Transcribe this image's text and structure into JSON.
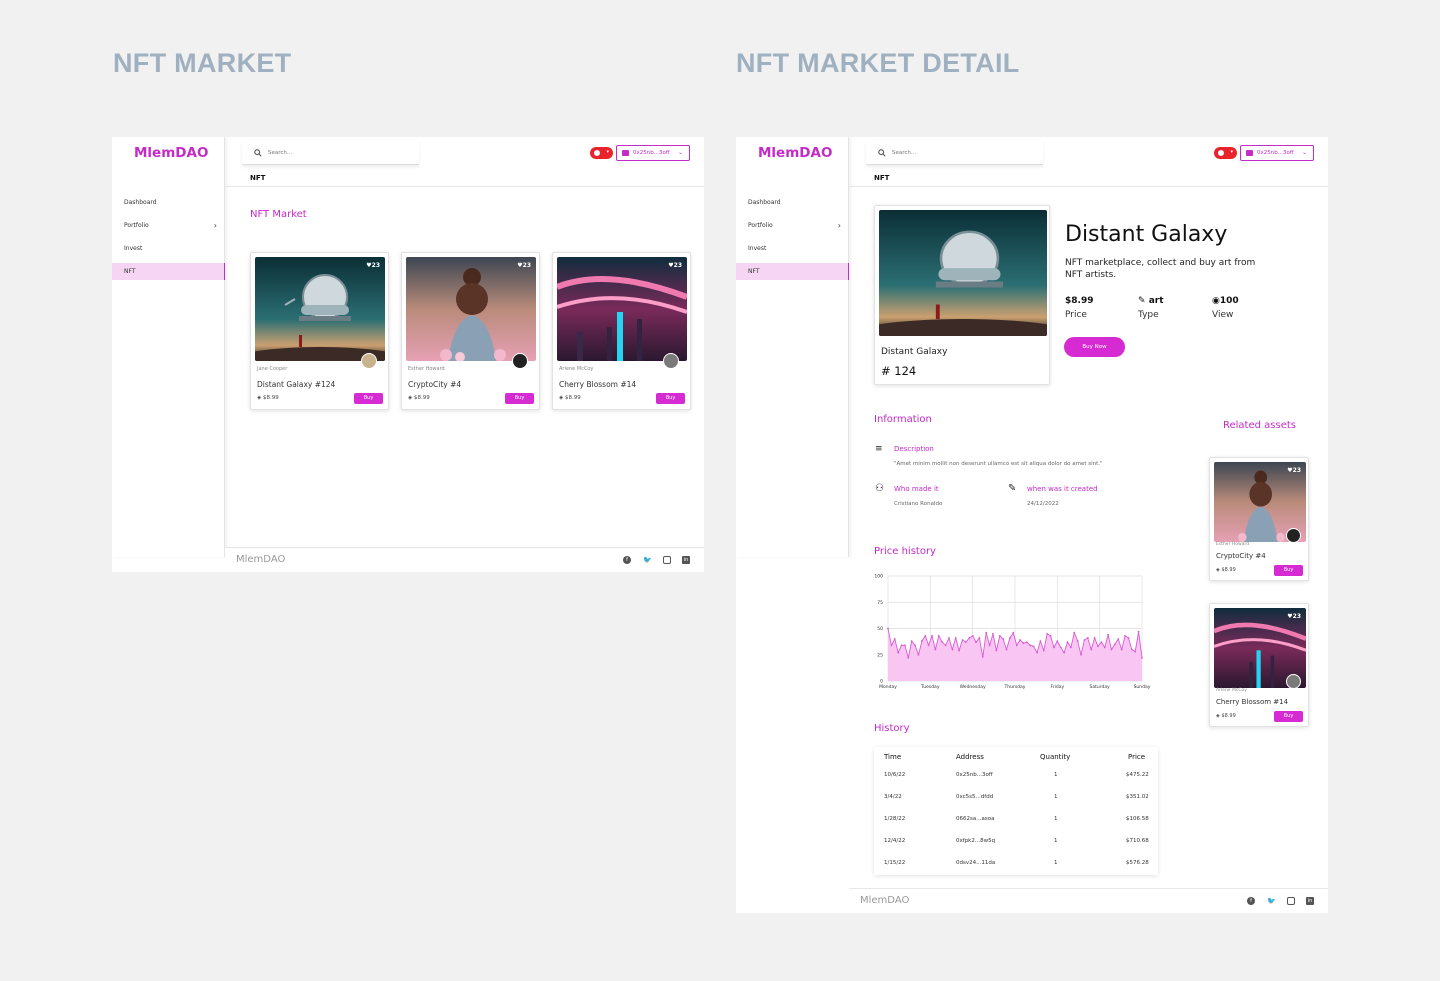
{
  "headings": {
    "left": "NFT MARKET",
    "right": "NFT MARKET DETAIL"
  },
  "brand": "MlemDAO",
  "sidebar": {
    "items": [
      {
        "label": "Dashboard",
        "has_chevron": false,
        "active": false
      },
      {
        "label": "Portfolio",
        "has_chevron": true,
        "active": false
      },
      {
        "label": "Invest",
        "has_chevron": false,
        "active": false
      },
      {
        "label": "NFT",
        "has_chevron": false,
        "active": true
      }
    ]
  },
  "search": {
    "placeholder": "Search..."
  },
  "wallet": {
    "address": "0x25nb...3off"
  },
  "breadcrumb": "NFT",
  "market": {
    "title": "NFT Market",
    "cards": [
      {
        "owner": "Jane Cooper",
        "name": "Distant Galaxy  #124",
        "price": "$8.99",
        "likes": "23",
        "buy": "Buy",
        "image": "galaxy"
      },
      {
        "owner": "Esther Howard",
        "name": "CryptoCity  #4",
        "price": "$8.99",
        "likes": "23",
        "buy": "Buy",
        "image": "girl"
      },
      {
        "owner": "Arlene McCoy",
        "name": "Cherry Blossom  #14",
        "price": "$8.99",
        "likes": "23",
        "buy": "Buy",
        "image": "city"
      }
    ]
  },
  "detail": {
    "title": "Distant Galaxy",
    "subtitle": "NFT marketplace, collect and buy art from NFT artists.",
    "card_name": "Distant Galaxy",
    "card_number": "# 124",
    "stats": [
      {
        "value": "$8.99",
        "label": "Price",
        "icon": "none"
      },
      {
        "value": "art",
        "label": "Type",
        "icon": "brush-icon"
      },
      {
        "value": "100",
        "label": "View",
        "icon": "eye-icon"
      }
    ],
    "buy_now": "Buy Now",
    "information": {
      "title": "Information",
      "description_label": "Description",
      "description_text": "\"Amet minim mollit non deserunt ullamco est sit aliqua dolor do amet sint.\"",
      "who_label": "Who made it",
      "who_value": "Cristiano Ronaldo",
      "when_label": "when was it created",
      "when_value": "24/12/2022"
    },
    "related": {
      "title": "Related assets",
      "cards": [
        {
          "owner": "Esther Howard",
          "name": "CryptoCity #4",
          "price": "$8.99",
          "likes": "23",
          "buy": "Buy",
          "image": "girl"
        },
        {
          "owner": "Arlene McCoy",
          "name": "Cherry Blossom #14",
          "price": "$8.99",
          "likes": "23",
          "buy": "Buy",
          "image": "city"
        }
      ]
    },
    "price_history": {
      "title": "Price history"
    },
    "history": {
      "title": "History",
      "columns": [
        "Time",
        "Address",
        "Quantity",
        "Price"
      ],
      "rows": [
        [
          "10/6/22",
          "0x25nb...3off",
          "1",
          "$475.22"
        ],
        [
          "3/4/22",
          "0xc5s5...dfdd",
          "1",
          "$351.02"
        ],
        [
          "1/28/22",
          "0662sa...asoa",
          "1",
          "$106.58"
        ],
        [
          "12/4/22",
          "0xfpk2...8w5q",
          "1",
          "$710.68"
        ],
        [
          "1/15/22",
          "0dsv24...11da",
          "1",
          "$576.28"
        ]
      ]
    }
  },
  "chart_data": {
    "type": "area",
    "title": "",
    "xlabel": "",
    "ylabel": "",
    "ylim": [
      0,
      100
    ],
    "yticks": [
      0,
      25,
      50,
      75,
      100
    ],
    "categories": [
      "Monday",
      "Tuesday",
      "Wednesday",
      "Thursday",
      "Friday",
      "Saturday",
      "Sunday"
    ],
    "values": [
      50,
      34,
      40,
      27,
      34,
      34,
      22,
      38,
      34,
      25,
      38,
      43,
      34,
      43,
      30,
      43,
      37,
      34,
      41,
      30,
      41,
      29,
      39,
      37,
      41,
      43,
      37,
      41,
      23,
      46,
      34,
      45,
      29,
      43,
      40,
      30,
      41,
      46,
      34,
      39,
      36,
      37,
      34,
      33,
      27,
      38,
      29,
      45,
      43,
      32,
      38,
      32,
      27,
      37,
      32,
      46,
      38,
      25,
      39,
      41,
      30,
      41,
      33,
      37,
      32,
      44,
      30,
      35,
      40,
      30,
      43,
      41,
      30,
      28,
      47,
      22
    ],
    "colors": {
      "line": "#d85cd2",
      "fill": "#f9c6f4"
    }
  },
  "colors": {
    "accent": "#c42bc8",
    "button": "#d62bd3",
    "heading": "#9fb0c1",
    "active_nav": "#f6d4f4"
  }
}
